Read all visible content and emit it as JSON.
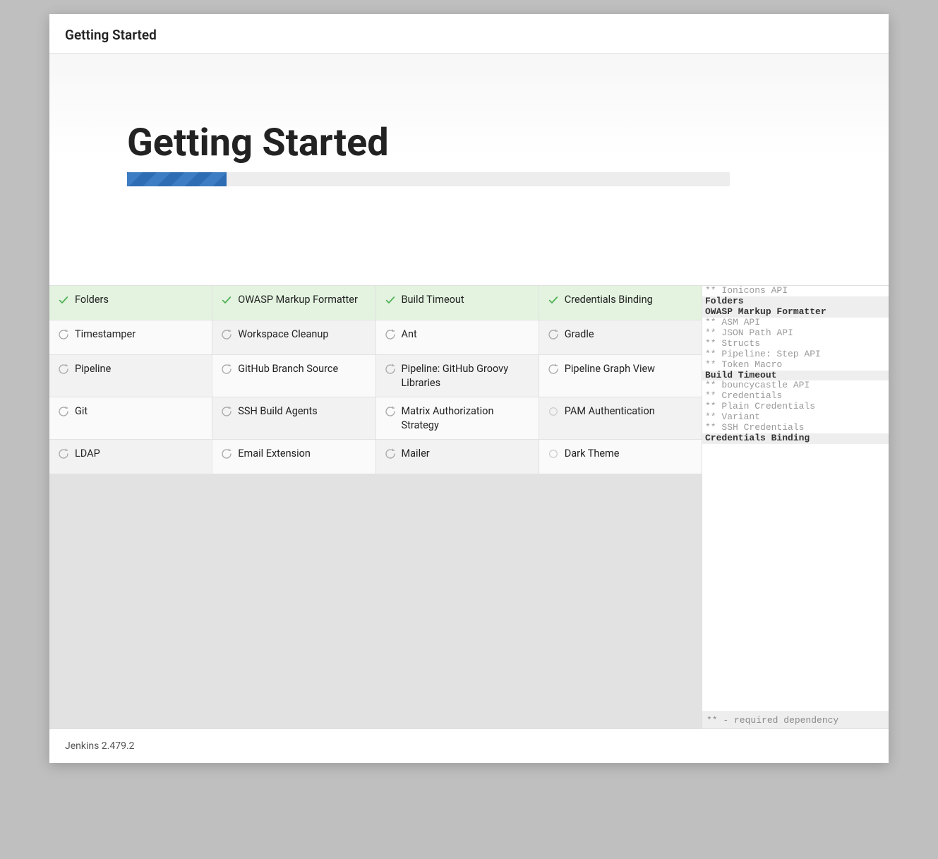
{
  "header": {
    "title": "Getting Started"
  },
  "hero": {
    "heading": "Getting Started"
  },
  "plugins": [
    {
      "name": "Folders",
      "status": "done"
    },
    {
      "name": "OWASP Markup Formatter",
      "status": "done"
    },
    {
      "name": "Build Timeout",
      "status": "done"
    },
    {
      "name": "Credentials Binding",
      "status": "done"
    },
    {
      "name": "Timestamper",
      "status": "installing"
    },
    {
      "name": "Workspace Cleanup",
      "status": "installing"
    },
    {
      "name": "Ant",
      "status": "installing"
    },
    {
      "name": "Gradle",
      "status": "installing"
    },
    {
      "name": "Pipeline",
      "status": "installing"
    },
    {
      "name": "GitHub Branch Source",
      "status": "installing"
    },
    {
      "name": "Pipeline: GitHub Groovy Libraries",
      "status": "installing"
    },
    {
      "name": "Pipeline Graph View",
      "status": "installing"
    },
    {
      "name": "Git",
      "status": "installing"
    },
    {
      "name": "SSH Build Agents",
      "status": "installing"
    },
    {
      "name": "Matrix Authorization Strategy",
      "status": "installing"
    },
    {
      "name": "PAM Authentication",
      "status": "pending"
    },
    {
      "name": "LDAP",
      "status": "installing"
    },
    {
      "name": "Email Extension",
      "status": "installing"
    },
    {
      "name": "Mailer",
      "status": "installing"
    },
    {
      "name": "Dark Theme",
      "status": "pending"
    }
  ],
  "log": {
    "lines": [
      {
        "text": "** Ionicons API",
        "type": "dep"
      },
      {
        "text": "Folders",
        "type": "main"
      },
      {
        "text": "OWASP Markup Formatter",
        "type": "main"
      },
      {
        "text": "** ASM API",
        "type": "dep"
      },
      {
        "text": "** JSON Path API",
        "type": "dep"
      },
      {
        "text": "** Structs",
        "type": "dep"
      },
      {
        "text": "** Pipeline: Step API",
        "type": "dep"
      },
      {
        "text": "** Token Macro",
        "type": "dep"
      },
      {
        "text": "Build Timeout",
        "type": "main"
      },
      {
        "text": "** bouncycastle API",
        "type": "dep"
      },
      {
        "text": "** Credentials",
        "type": "dep"
      },
      {
        "text": "** Plain Credentials",
        "type": "dep"
      },
      {
        "text": "** Variant",
        "type": "dep"
      },
      {
        "text": "** SSH Credentials",
        "type": "dep"
      },
      {
        "text": "Credentials Binding",
        "type": "main"
      }
    ],
    "footer": "** - required dependency"
  },
  "footer": {
    "version": "Jenkins 2.479.2"
  }
}
